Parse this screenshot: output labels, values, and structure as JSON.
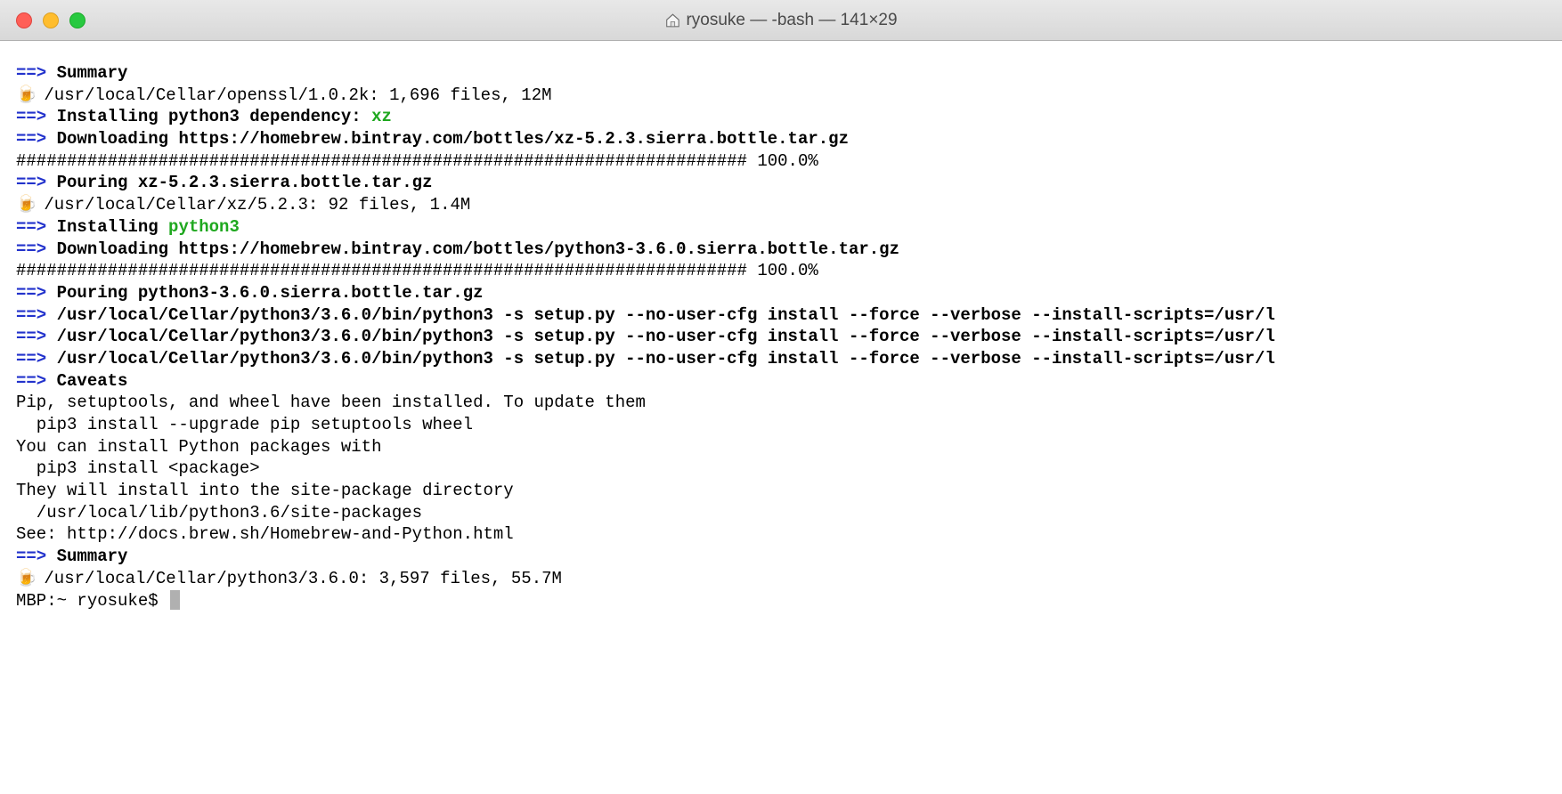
{
  "titlebar": {
    "title": "ryosuke — -bash — 141×29"
  },
  "terminal": {
    "arrow": "==>",
    "beer_emoji": "🍺",
    "lines": [
      {
        "type": "header",
        "text": "Summary"
      },
      {
        "type": "beer",
        "text": "/usr/local/Cellar/openssl/1.0.2k: 1,696 files, 12M"
      },
      {
        "type": "header_green",
        "prefix": "Installing python3 dependency: ",
        "green_text": "xz"
      },
      {
        "type": "header",
        "text": "Downloading https://homebrew.bintray.com/bottles/xz-5.2.3.sierra.bottle.tar.gz"
      },
      {
        "type": "plain",
        "text": "######################################################################## 100.0%"
      },
      {
        "type": "header",
        "text": "Pouring xz-5.2.3.sierra.bottle.tar.gz"
      },
      {
        "type": "beer",
        "text": "/usr/local/Cellar/xz/5.2.3: 92 files, 1.4M"
      },
      {
        "type": "header_green",
        "prefix": "Installing ",
        "green_text": "python3"
      },
      {
        "type": "header",
        "text": "Downloading https://homebrew.bintray.com/bottles/python3-3.6.0.sierra.bottle.tar.gz"
      },
      {
        "type": "plain",
        "text": "######################################################################## 100.0%"
      },
      {
        "type": "header",
        "text": "Pouring python3-3.6.0.sierra.bottle.tar.gz"
      },
      {
        "type": "header",
        "text": "/usr/local/Cellar/python3/3.6.0/bin/python3 -s setup.py --no-user-cfg install --force --verbose --install-scripts=/usr/l"
      },
      {
        "type": "header",
        "text": "/usr/local/Cellar/python3/3.6.0/bin/python3 -s setup.py --no-user-cfg install --force --verbose --install-scripts=/usr/l"
      },
      {
        "type": "header",
        "text": "/usr/local/Cellar/python3/3.6.0/bin/python3 -s setup.py --no-user-cfg install --force --verbose --install-scripts=/usr/l"
      },
      {
        "type": "header",
        "text": "Caveats"
      },
      {
        "type": "plain",
        "text": "Pip, setuptools, and wheel have been installed. To update them"
      },
      {
        "type": "plain",
        "text": "  pip3 install --upgrade pip setuptools wheel"
      },
      {
        "type": "plain",
        "text": ""
      },
      {
        "type": "plain",
        "text": "You can install Python packages with"
      },
      {
        "type": "plain",
        "text": "  pip3 install <package>"
      },
      {
        "type": "plain",
        "text": ""
      },
      {
        "type": "plain",
        "text": "They will install into the site-package directory"
      },
      {
        "type": "plain",
        "text": "  /usr/local/lib/python3.6/site-packages"
      },
      {
        "type": "plain",
        "text": ""
      },
      {
        "type": "plain",
        "text": "See: http://docs.brew.sh/Homebrew-and-Python.html"
      },
      {
        "type": "header",
        "text": "Summary"
      },
      {
        "type": "beer",
        "text": "/usr/local/Cellar/python3/3.6.0: 3,597 files, 55.7M"
      }
    ],
    "prompt": "MBP:~ ryosuke$ "
  }
}
